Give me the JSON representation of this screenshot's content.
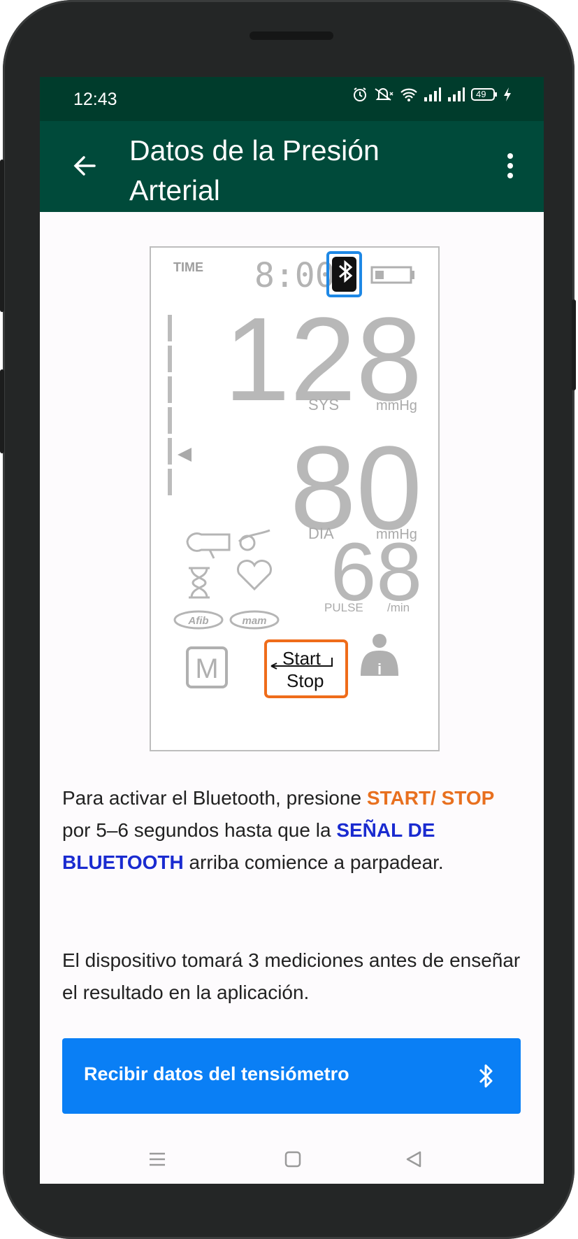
{
  "status_bar": {
    "time": "12:43",
    "battery_level": "49",
    "icons": [
      "alarm-icon",
      "mute-icon",
      "wifi-icon",
      "signal-icon",
      "signal-icon",
      "battery-icon",
      "charging-icon"
    ]
  },
  "app_bar": {
    "title": "Datos de la Presión Arterial",
    "back_icon": "arrow-left-icon",
    "menu_icon": "more-vert-icon"
  },
  "device_display": {
    "time_label": "TIME",
    "time_value": "8:00",
    "systolic": "128",
    "sys_label": "SYS",
    "sys_unit": "mmHg",
    "diastolic": "80",
    "dia_label": "DIA",
    "dia_unit": "mmHg",
    "pulse": "68",
    "pulse_label": "PULSE",
    "pulse_unit": "/min",
    "afib_label": "Afib",
    "mam_label": "mam",
    "memory_label": "M",
    "start_label": "Start",
    "stop_label": "Stop",
    "highlight_bluetooth_color": "#1e88e5",
    "highlight_start_color": "#ef6c1a"
  },
  "instructions": {
    "part1": "Para activar el Bluetooth, presione ",
    "start_stop": "START/ STOP",
    "part2": " por 5–6 segundos hasta que la ",
    "bluetooth_signal": "SEÑAL DE BLUETOOTH",
    "part3": " arriba comience a parpadear.",
    "note": "El dispositivo tomará 3 mediciones antes de enseñar el resultado en la aplicación."
  },
  "cta_button": {
    "label": "Recibir datos del tensiómetro",
    "icon": "bluetooth-icon",
    "color": "#0a7ff5"
  },
  "nav_bar": {
    "icons": [
      "recents-icon",
      "home-icon",
      "back-icon"
    ]
  }
}
